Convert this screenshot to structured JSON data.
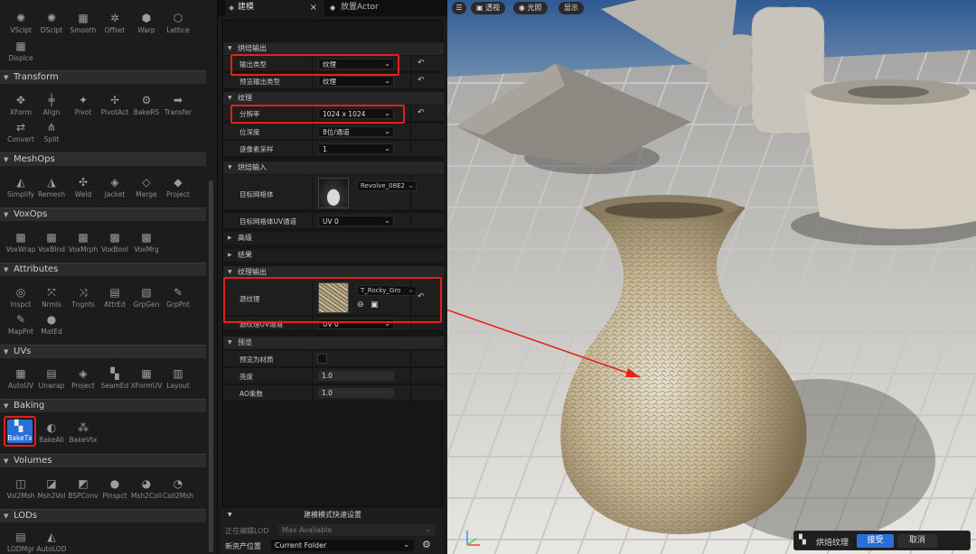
{
  "palette": {
    "sections": {
      "transform": "Transform",
      "meshops": "MeshOps",
      "voxops": "VoxOps",
      "attributes": "Attributes",
      "uvs": "UVs",
      "baking": "Baking",
      "volumes": "Volumes",
      "lods": "LODs"
    },
    "tools": {
      "vsculpt": "VSclpt",
      "dsculpt": "DSclpt",
      "smooth": "Smooth",
      "offset": "Offset",
      "warp": "Warp",
      "lattice": "Lattice",
      "displace": "Displce",
      "xform": "XForm",
      "align": "Align",
      "pivot": "Pivot",
      "pivotact": "PivotAct",
      "bakers": "BakeRS",
      "transfer": "Transfer",
      "convert": "Convert",
      "split": "Split",
      "simplify": "Simplify",
      "remesh": "Remesh",
      "weld": "Weld",
      "jacket": "Jacket",
      "merge": "Merge",
      "project": "Project",
      "voxwrap": "VoxWrap",
      "voxblnd": "VoxBlnd",
      "voxmrph": "VoxMrph",
      "voxbool": "VoxBool",
      "voxmrg": "VoxMrg",
      "inspct": "Inspct",
      "nrmls": "Nrmls",
      "tngnts": "Tngnts",
      "attred": "AttrEd",
      "grpgen": "GrpGen",
      "grppnt": "GrpPnt",
      "mappnt": "MapPnt",
      "mated": "MatEd",
      "autouv": "AutoUV",
      "unwrap": "Unwrap",
      "uvproject": "Project",
      "seamed": "SeamEd",
      "xformuv": "XFormUV",
      "layout": "Layout",
      "baketx": "BakeTx",
      "bakeall": "BakeAll",
      "bakevtx": "BakeVtx",
      "vol2msh": "Vol2Msh",
      "msh2vol": "Msh2Vol",
      "bspconv": "BSPConv",
      "plnspct": "Plnspct",
      "msh2coll": "Msh2Coll",
      "coll2msh": "Coll2Msh",
      "lodmgr": "LODMgr",
      "autolod": "AutoLOD"
    }
  },
  "details": {
    "tab_modeling": "建模",
    "tab_place_actor": "放置Actor",
    "sec_bake_output": "烘焙输出",
    "output_type_label": "输出类型",
    "output_type_value": "纹理",
    "preview_output_type_label": "预览输出类型",
    "preview_output_type_value": "纹理",
    "sec_texture": "纹理",
    "resolution_label": "分辨率",
    "resolution_value": "1024 x 1024",
    "bit_depth_label": "位深度",
    "bit_depth_value": "8位/通道",
    "subsample_label": "逐像素采样",
    "subsample_value": "1",
    "sec_bake_input": "烘焙输入",
    "target_mesh_label": "目标网格体",
    "target_mesh_value": "Revolve_08E2",
    "target_uv_label": "目标网格体UV通道",
    "target_uv_value": "UV 0",
    "sec_advanced": "高级",
    "sec_result": "结果",
    "sec_texture_output": "纹理输出",
    "source_texture_label": "源纹理",
    "source_texture_value": "T_Rocky_Gro",
    "source_uv_label": "源纹理UV通道",
    "source_uv_value": "UV 0",
    "sec_preview": "预览",
    "preview_material_label": "预览为材质",
    "brightness_label": "亮度",
    "brightness_value": "1.0",
    "ao_label": "AO乘数",
    "ao_value": "1.0",
    "quick_settings": "建模模式快速设置",
    "editing_lod_label": "正在编辑LOD",
    "editing_lod_value": "Max Available",
    "new_asset_location_label": "新资产位置",
    "new_asset_location_value": "Current Folder"
  },
  "viewport": {
    "perspective": "透视",
    "lighting": "光照",
    "show": "显示",
    "bake_label": "烘焙纹理",
    "accept": "接受",
    "cancel": "取消"
  },
  "colors": {
    "accent": "#2a6fd6",
    "highlight": "#e3201b"
  }
}
